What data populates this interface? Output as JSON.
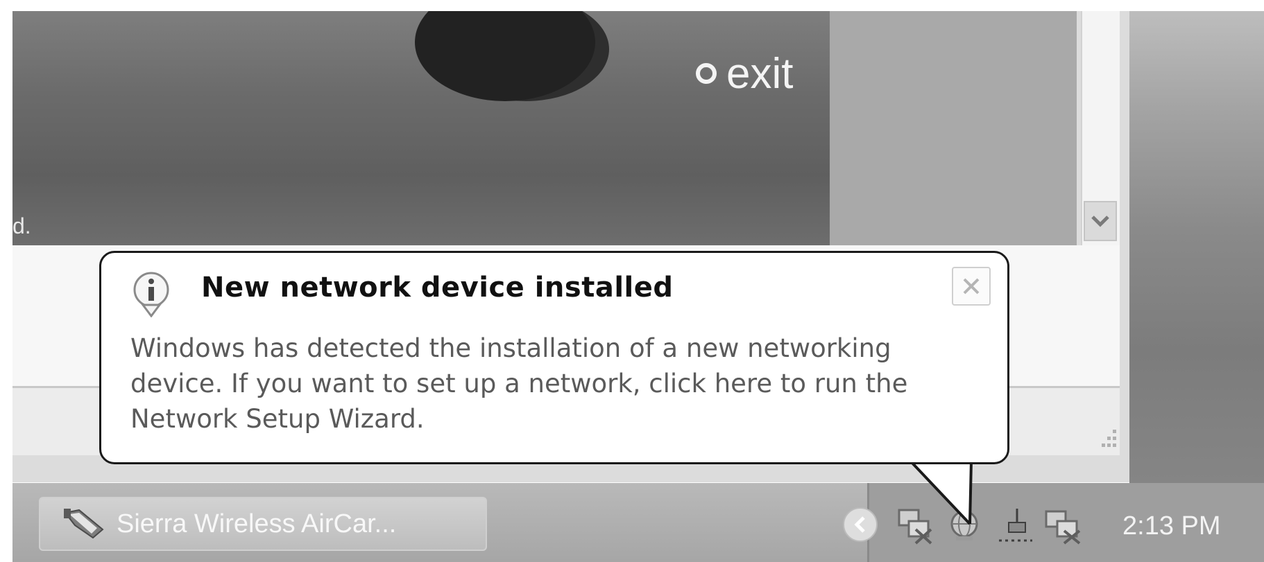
{
  "window": {
    "exit_label": "exit",
    "truncated_text": "d."
  },
  "notification": {
    "title": "New network device installed",
    "body_lines": [
      "Windows has detected the installation of a new networking",
      "device. If you want to set up a network, click here to run the",
      "Network Setup Wizard."
    ],
    "icon": "info-icon",
    "close_icon": "close-icon"
  },
  "taskbar": {
    "task_button_label": "Sierra Wireless AirCar...",
    "task_button_icon": "sierra-wireless-app-icon",
    "tray": {
      "chevron_icon": "chevron-left-icon",
      "icons": [
        "network-disconnected-icon",
        "network-globe-icon",
        "safely-remove-hardware-icon",
        "network-connection-icon"
      ],
      "clock": "2:13 PM"
    }
  }
}
